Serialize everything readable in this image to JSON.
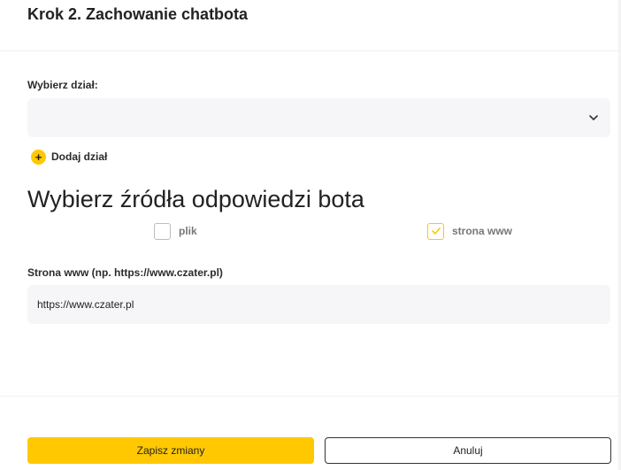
{
  "header": {
    "title": "Krok 2. Zachowanie chatbota"
  },
  "department": {
    "label": "Wybierz dział:",
    "selected": "",
    "add_label": "Dodaj dział",
    "add_icon": "plus-icon"
  },
  "sources": {
    "heading": "Wybierz źródła odpowiedzi bota",
    "options": [
      {
        "label": "plik",
        "checked": false
      },
      {
        "label": "strona www",
        "checked": true
      }
    ]
  },
  "website": {
    "label": "Strona www (np. https://www.czater.pl)",
    "value": "https://www.czater.pl"
  },
  "actions": {
    "save_label": "Zapisz zmiany",
    "cancel_label": "Anuluj"
  },
  "colors": {
    "accent": "#ffc800",
    "field_bg": "#f6f6f8"
  }
}
